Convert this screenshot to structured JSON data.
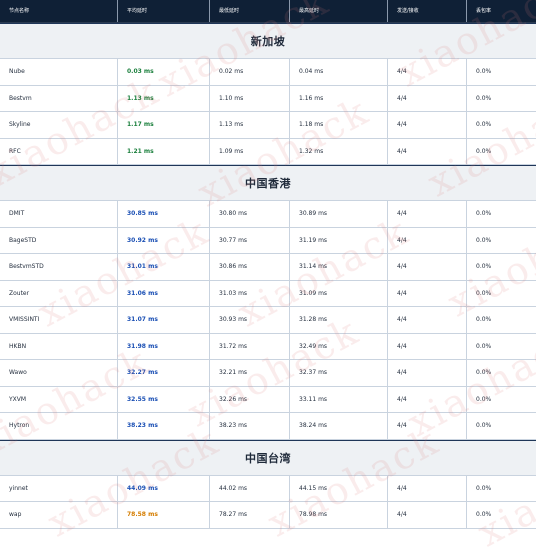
{
  "headers": [
    "节点名称",
    "平均延时",
    "最低延时",
    "最高延时",
    "发送/接收",
    "丢包率"
  ],
  "watermark_text": "xiaohack",
  "sections": [
    {
      "title": "新加坡",
      "rows": [
        {
          "name": "Nube",
          "avg": "0.03 ms",
          "min": "0.02 ms",
          "max": "0.04 ms",
          "sent": "4/4",
          "loss": "0.0%",
          "avg_color": "green"
        },
        {
          "name": "Bestvm",
          "avg": "1.13 ms",
          "min": "1.10 ms",
          "max": "1.16 ms",
          "sent": "4/4",
          "loss": "0.0%",
          "avg_color": "green"
        },
        {
          "name": "Skyline",
          "avg": "1.17 ms",
          "min": "1.13 ms",
          "max": "1.18 ms",
          "sent": "4/4",
          "loss": "0.0%",
          "avg_color": "green"
        },
        {
          "name": "RFC",
          "avg": "1.21 ms",
          "min": "1.09 ms",
          "max": "1.32 ms",
          "sent": "4/4",
          "loss": "0.0%",
          "avg_color": "green"
        }
      ]
    },
    {
      "title": "中国香港",
      "rows": [
        {
          "name": "DMIT",
          "avg": "30.85 ms",
          "min": "30.80 ms",
          "max": "30.89 ms",
          "sent": "4/4",
          "loss": "0.0%",
          "avg_color": "blue"
        },
        {
          "name": "BageSTD",
          "avg": "30.92 ms",
          "min": "30.77 ms",
          "max": "31.19 ms",
          "sent": "4/4",
          "loss": "0.0%",
          "avg_color": "blue"
        },
        {
          "name": "BestvmSTD",
          "avg": "31.01 ms",
          "min": "30.86 ms",
          "max": "31.14 ms",
          "sent": "4/4",
          "loss": "0.0%",
          "avg_color": "blue"
        },
        {
          "name": "Zouter",
          "avg": "31.06 ms",
          "min": "31.03 ms",
          "max": "31.09 ms",
          "sent": "4/4",
          "loss": "0.0%",
          "avg_color": "blue"
        },
        {
          "name": "VMISSINTI",
          "avg": "31.07 ms",
          "min": "30.93 ms",
          "max": "31.28 ms",
          "sent": "4/4",
          "loss": "0.0%",
          "avg_color": "blue"
        },
        {
          "name": "HKBN",
          "avg": "31.98 ms",
          "min": "31.72 ms",
          "max": "32.49 ms",
          "sent": "4/4",
          "loss": "0.0%",
          "avg_color": "blue"
        },
        {
          "name": "Wawo",
          "avg": "32.27 ms",
          "min": "32.21 ms",
          "max": "32.37 ms",
          "sent": "4/4",
          "loss": "0.0%",
          "avg_color": "blue"
        },
        {
          "name": "YXVM",
          "avg": "32.55 ms",
          "min": "32.26 ms",
          "max": "33.11 ms",
          "sent": "4/4",
          "loss": "0.0%",
          "avg_color": "blue"
        },
        {
          "name": "Hytron",
          "avg": "38.23 ms",
          "min": "38.23 ms",
          "max": "38.24 ms",
          "sent": "4/4",
          "loss": "0.0%",
          "avg_color": "blue"
        }
      ]
    },
    {
      "title": "中国台湾",
      "rows": [
        {
          "name": "yinnet",
          "avg": "44.09 ms",
          "min": "44.02 ms",
          "max": "44.15 ms",
          "sent": "4/4",
          "loss": "0.0%",
          "avg_color": "blue"
        },
        {
          "name": "wap",
          "avg": "78.58 ms",
          "min": "78.27 ms",
          "max": "78.98 ms",
          "sent": "4/4",
          "loss": "0.0%",
          "avg_color": "orange"
        }
      ]
    }
  ]
}
